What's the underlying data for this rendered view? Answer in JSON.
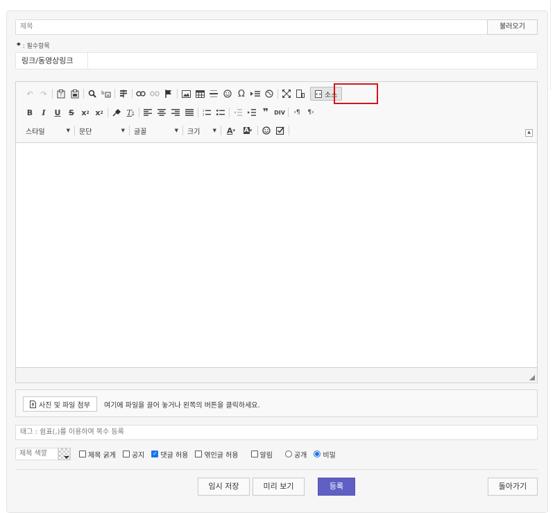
{
  "form": {
    "title_placeholder": "제목",
    "load_button": "불러오기",
    "required_mark": "*",
    "required_text": ": 필수항목",
    "link_label": "링크/동영상링크",
    "link_value": ""
  },
  "editor": {
    "source_label": "소스",
    "style_label": "스타일",
    "paragraph_label": "문단",
    "font_label": "글꼴",
    "size_label": "크기"
  },
  "upload": {
    "button_label": "사진 및 파일 첨부",
    "hint": "여기에 파일을 끌어 놓거나 왼쪽의 버튼을 클릭하세요."
  },
  "tags": {
    "placeholder": "태그 : 쉼표(,)를 이용하여 복수 등록"
  },
  "options": {
    "title_color_placeholder": "제목 색깔",
    "bold_title": {
      "label": "제목 굵게",
      "checked": false
    },
    "notice": {
      "label": "공지",
      "checked": false
    },
    "allow_comments": {
      "label": "댓글 허용",
      "checked": true
    },
    "allow_trackback": {
      "label": "엮인글 허용",
      "checked": false
    },
    "notify": {
      "label": "알림",
      "checked": false
    },
    "visibility_public": {
      "label": "공개",
      "selected": false
    },
    "visibility_secret": {
      "label": "비밀",
      "selected": true
    }
  },
  "buttons": {
    "temp_save": "임시 저장",
    "preview": "미리 보기",
    "submit": "등록",
    "back": "돌아가기"
  },
  "colors": {
    "accent": "#5f5fc4",
    "highlight": "#d4141a",
    "checkbox": "#1a73e8"
  }
}
